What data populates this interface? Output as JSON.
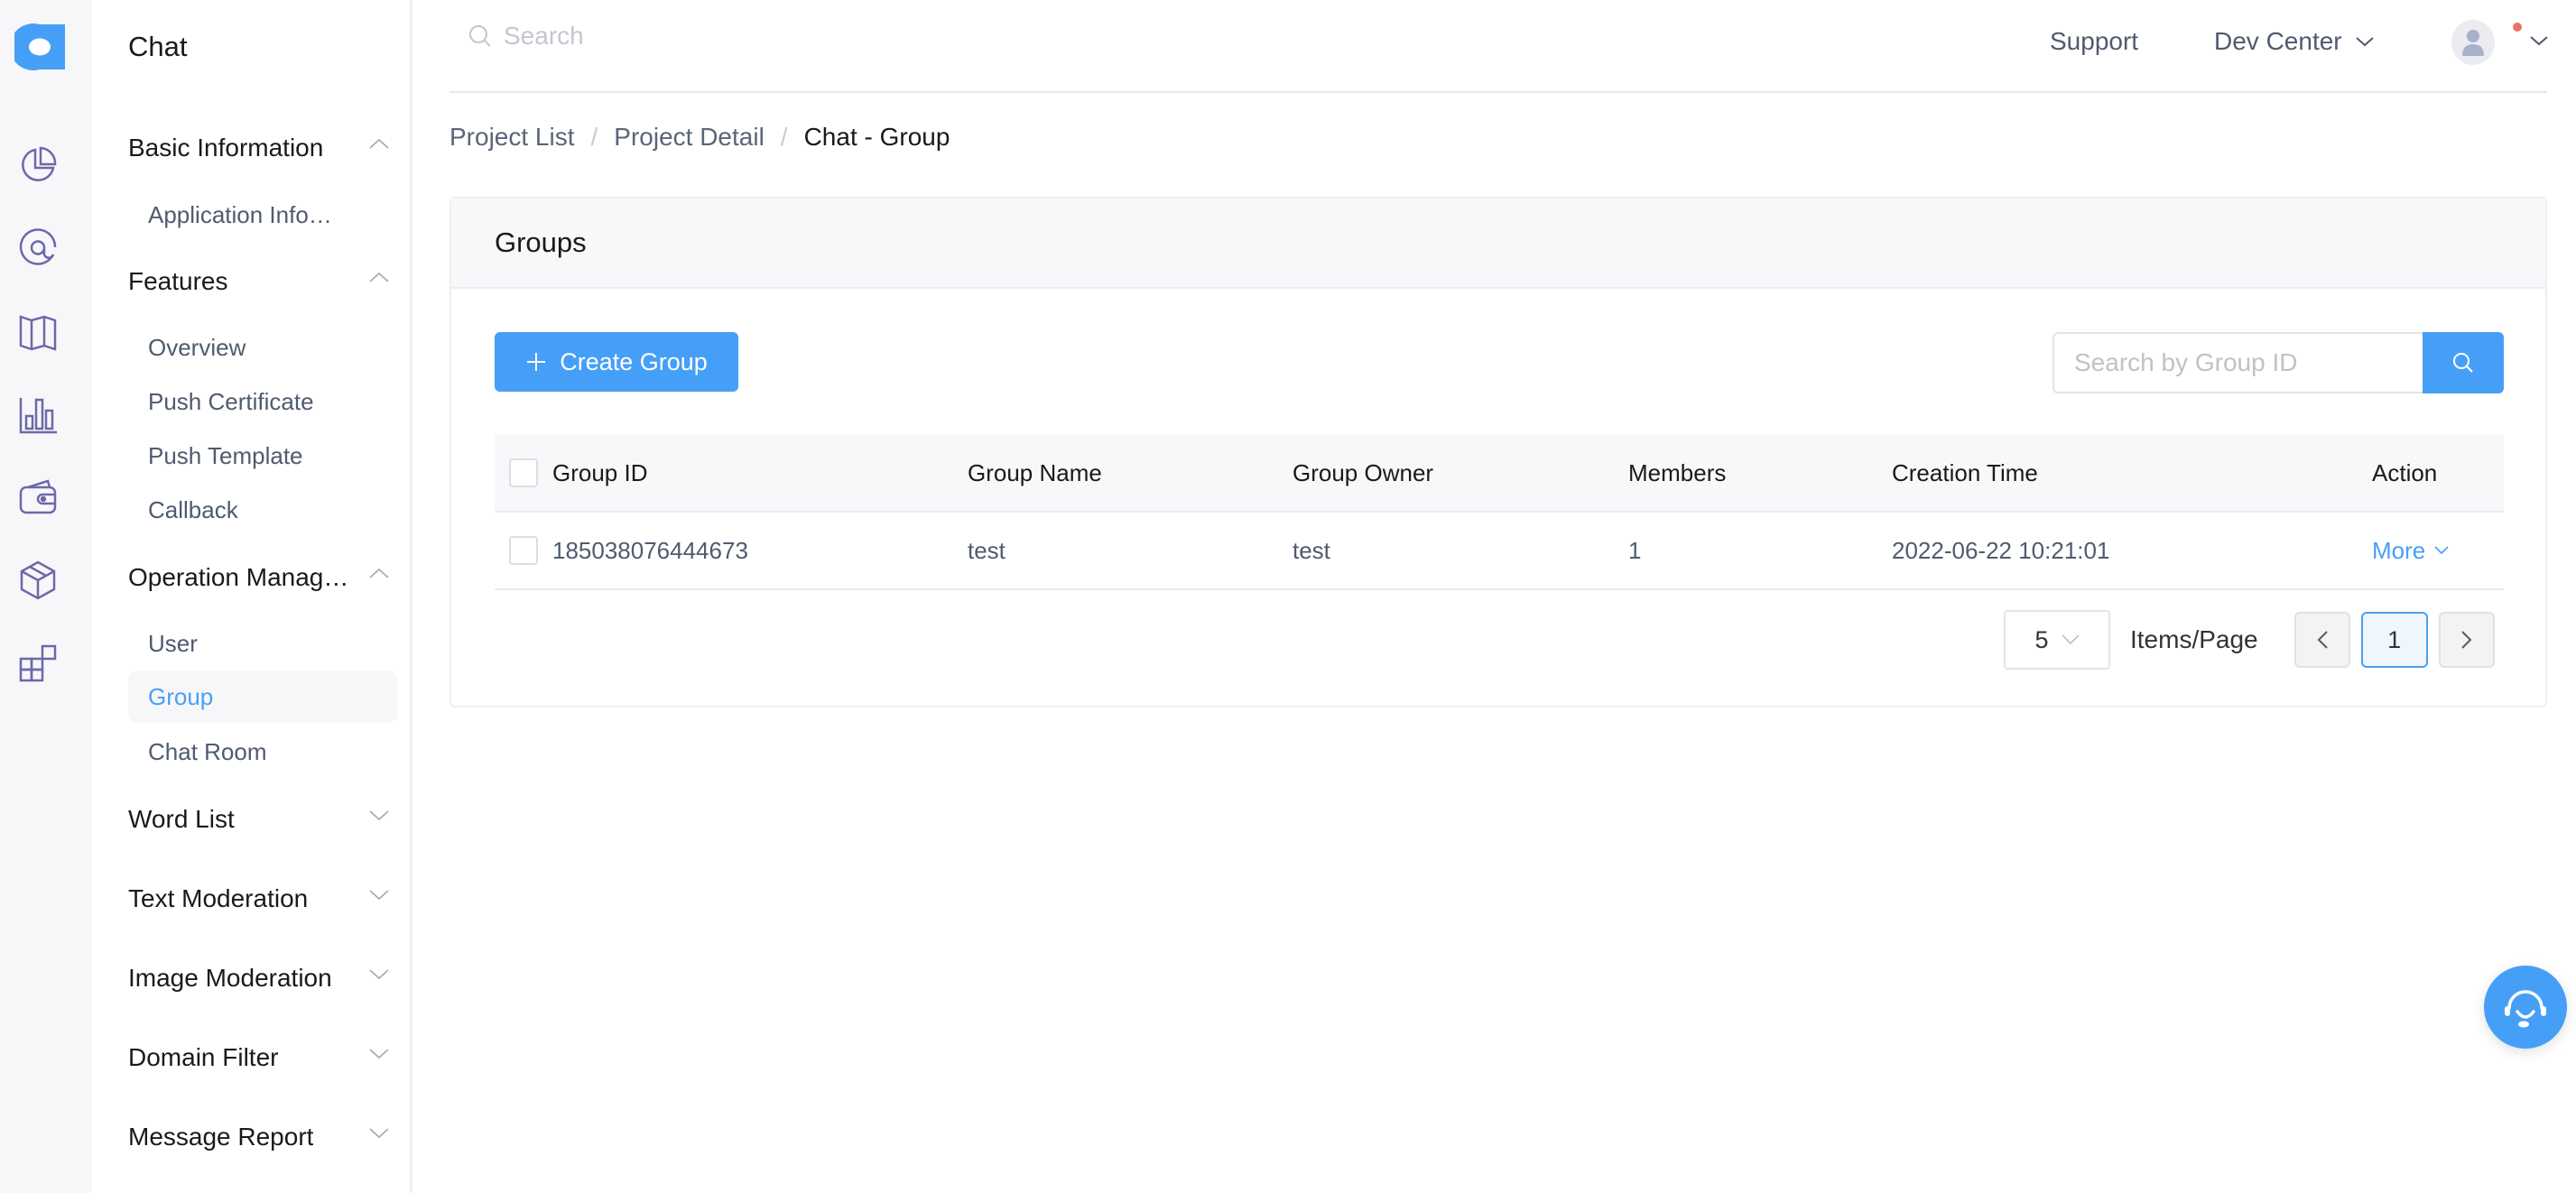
{
  "app": {
    "title": "Chat",
    "brand_color": "#469ff6"
  },
  "rail": {
    "icons": [
      {
        "name": "logo-icon"
      },
      {
        "name": "pie-chart-icon"
      },
      {
        "name": "at-sign-icon"
      },
      {
        "name": "map-icon"
      },
      {
        "name": "bar-chart-icon"
      },
      {
        "name": "wallet-icon"
      },
      {
        "name": "box-icon"
      },
      {
        "name": "apps-grid-icon"
      }
    ]
  },
  "sidebar": {
    "groups": [
      {
        "label": "Basic Information",
        "expanded": true,
        "items": [
          "Application Info…"
        ]
      },
      {
        "label": "Features",
        "expanded": true,
        "items": [
          "Overview",
          "Push Certificate",
          "Push Template",
          "Callback"
        ]
      },
      {
        "label": "Operation Manag…",
        "expanded": true,
        "items": [
          "User",
          "Group",
          "Chat Room"
        ],
        "active_item": "Group"
      },
      {
        "label": "Word List",
        "expanded": false,
        "items": []
      },
      {
        "label": "Text Moderation",
        "expanded": false,
        "items": []
      },
      {
        "label": "Image Moderation",
        "expanded": false,
        "items": []
      },
      {
        "label": "Domain Filter",
        "expanded": false,
        "items": []
      },
      {
        "label": "Message Report",
        "expanded": false,
        "items": []
      }
    ]
  },
  "topbar": {
    "search_placeholder": "Search",
    "support": "Support",
    "dev_center": "Dev Center",
    "notification_dot_color": "#e8716e"
  },
  "breadcrumb": {
    "items": [
      "Project List",
      "Project Detail",
      "Chat - Group"
    ],
    "separator": "/"
  },
  "groups_card": {
    "title": "Groups",
    "create_button": "Create Group",
    "search_placeholder": "Search by Group ID",
    "table": {
      "columns": [
        "Group ID",
        "Group Name",
        "Group Owner",
        "Members",
        "Creation Time",
        "Action"
      ],
      "rows": [
        {
          "group_id": "185038076444673",
          "group_name": "test",
          "group_owner": "test",
          "members": "1",
          "creation_time": "2022-06-22 10:21:01",
          "action": "More"
        }
      ]
    },
    "pagination": {
      "page_size": "5",
      "page_size_label": "Items/Page",
      "current_page": "1"
    }
  }
}
